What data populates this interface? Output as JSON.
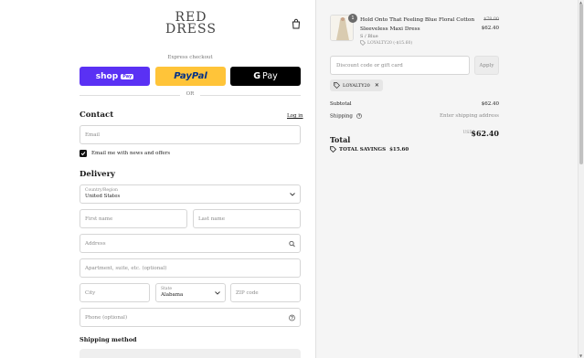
{
  "brand": {
    "line1": "RED",
    "line2": "DRESS"
  },
  "express": {
    "label": "Express checkout",
    "shop_pay": {
      "word": "shop",
      "badge": "Pay"
    },
    "paypal": "PayPal",
    "gpay": {
      "g": "G",
      "word": "Pay"
    }
  },
  "or_label": "OR",
  "contact": {
    "title": "Contact",
    "login": "Log in",
    "email_placeholder": "Email",
    "newsletter_label": "Email me with news and offers",
    "newsletter_checked": true
  },
  "delivery": {
    "title": "Delivery",
    "country_label": "Country/Region",
    "country_value": "United States",
    "first_name": "First name",
    "last_name": "Last name",
    "address": "Address",
    "apartment": "Apartment, suite, etc. (optional)",
    "city": "City",
    "state_label": "State",
    "state_value": "Alabama",
    "zip": "ZIP code",
    "phone": "Phone (optional)"
  },
  "shipping_method_title": "Shipping method",
  "order": {
    "quantity": "1",
    "product_name": "Hold Onto That Feeling Blue Floral Cotton Sleeveless Maxi Dress",
    "variant": "S / Blue",
    "discount_note": "LOYALTY20 (-$15.60)",
    "price_original": "$78.00",
    "price_final": "$62.40"
  },
  "discount": {
    "placeholder": "Discount code or gift card",
    "apply": "Apply",
    "applied_code": "LOYALTY20"
  },
  "summary": {
    "subtotal_label": "Subtotal",
    "subtotal_value": "$62.40",
    "shipping_label": "Shipping",
    "shipping_value": "Enter shipping address",
    "total_label": "Total",
    "currency": "USD",
    "total_value": "$62.40",
    "savings_label": "TOTAL SAVINGS",
    "savings_value": "$15.60"
  },
  "colors": {
    "shop_pay": "#5a31f4",
    "paypal": "#ffc439",
    "gpay": "#000000",
    "sidebar_bg": "#f5f5f5"
  }
}
